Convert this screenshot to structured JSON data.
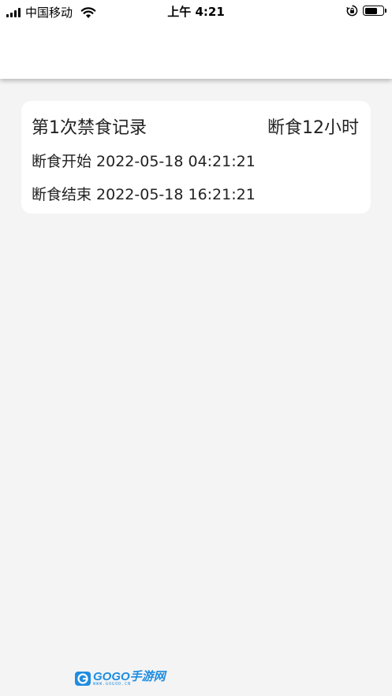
{
  "status_bar": {
    "carrier": "中国移动",
    "time": "上午 4:21",
    "battery_level": 0.7
  },
  "record": {
    "title": "第1次禁食记录",
    "duration": "断食12小时",
    "start_label": "断食开始",
    "start_time": "2022-05-18 04:21:21",
    "end_label": "断食结束",
    "end_time": "2022-05-18 16:21:21"
  },
  "watermark": {
    "brand": "GOGO手游网",
    "url": "WWW.GOGOD.CN"
  },
  "colors": {
    "page_background": "#f4f4f4",
    "card_background": "#ffffff",
    "watermark_blue": "#1f8de0"
  }
}
